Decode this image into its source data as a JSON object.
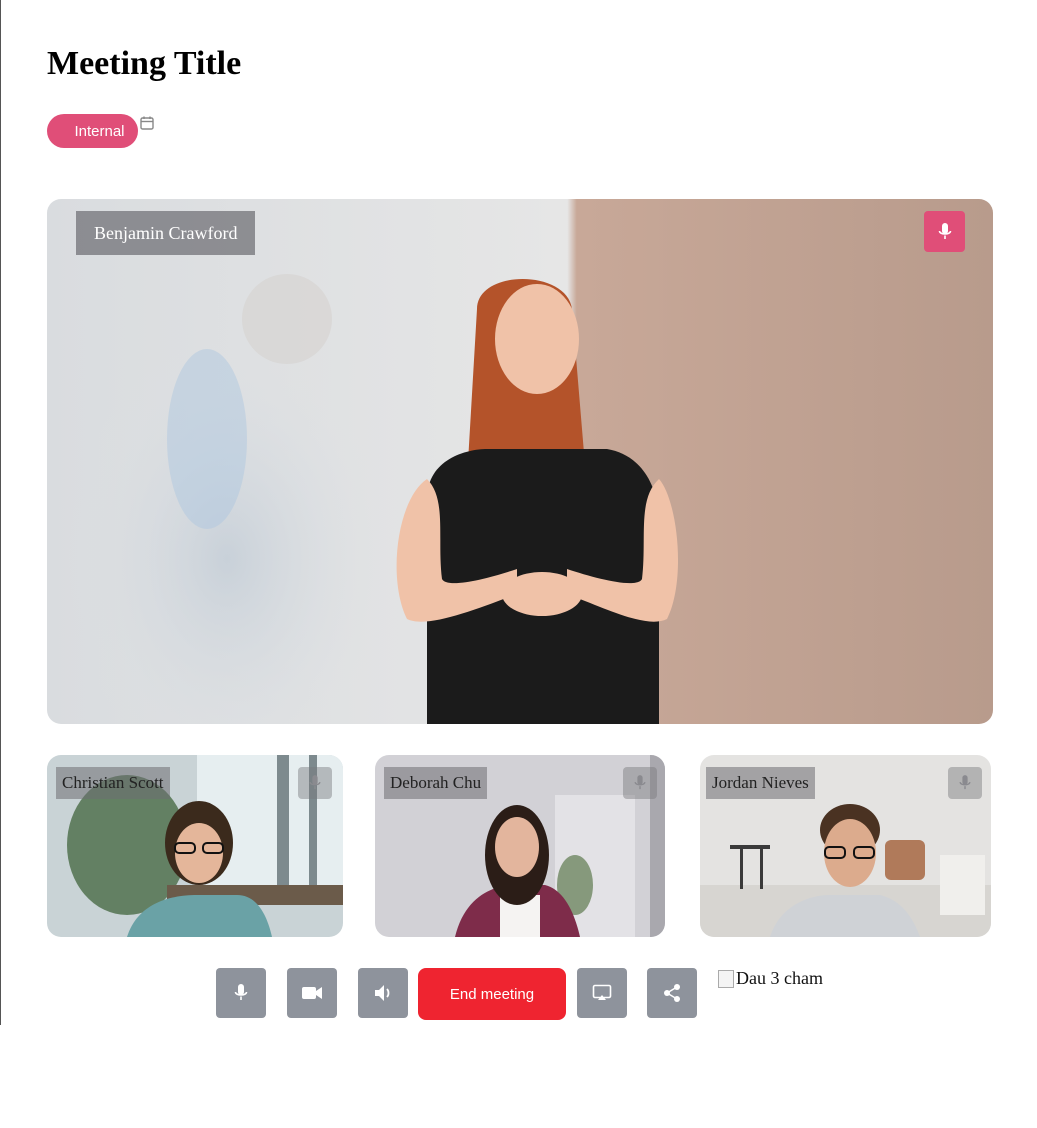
{
  "meeting": {
    "title": "Meeting Title",
    "tag": "Internal",
    "tag_color": "#e04e78"
  },
  "icons": {
    "calendar": "calendar-icon",
    "mic": "microphone-icon",
    "camera": "video-camera-icon",
    "speaker": "speaker-icon",
    "screen": "screen-share-icon",
    "share": "share-icon"
  },
  "main_speaker": {
    "name": "Benjamin Crawford"
  },
  "participants": [
    {
      "name": "Christian Scott"
    },
    {
      "name": "Deborah Chu"
    },
    {
      "name": "Jordan Nieves"
    }
  ],
  "controls": {
    "end_label": "End meeting",
    "end_color": "#ef2430",
    "more_alt": "Dau 3 cham"
  }
}
